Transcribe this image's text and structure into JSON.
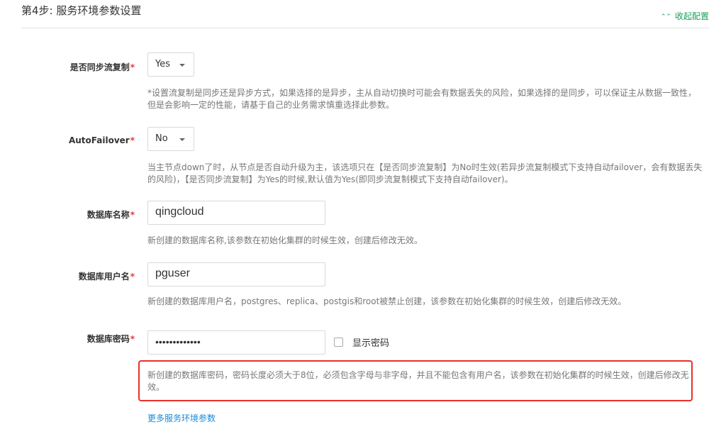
{
  "header": {
    "title": "第4步: 服务环境参数设置",
    "collapse_label": "收起配置",
    "collapse_icon": "double-chevron-up-icon"
  },
  "fields": {
    "sync_replication": {
      "label": "是否同步流复制",
      "required_mark": "*",
      "value": "Yes",
      "help": "*设置流复制是同步还是异步方式，如果选择的是异步，主从自动切换时可能会有数据丢失的风险，如果选择的是同步，可以保证主从数据一致性，但是会影响一定的性能，请基于自己的业务需求慎重选择此参数。"
    },
    "auto_failover": {
      "label": "AutoFailover",
      "required_mark": "*",
      "value": "No",
      "help": "当主节点down了时，从节点是否自动升级为主，该选项只在【是否同步流复制】为No时生效(若异步流复制模式下支持自动failover，会有数据丢失的风险)，【是否同步流复制】为Yes的时候,默认值为Yes(即同步流复制模式下支持自动failover)。"
    },
    "db_name": {
      "label": "数据库名称",
      "required_mark": "*",
      "value": "qingcloud",
      "help": "新创建的数据库名称,该参数在初始化集群的时候生效，创建后修改无效。"
    },
    "db_user": {
      "label": "数据库用户名",
      "required_mark": "*",
      "value": "pguser",
      "help": "新创建的数据库用户名，postgres、replica、postgis和root被禁止创建，该参数在初始化集群的时候生效，创建后修改无效。"
    },
    "db_password": {
      "label": "数据库密码",
      "required_mark": "*",
      "masked_value": "•••••••••••••",
      "show_password_label": "显示密码",
      "show_password_checked": false,
      "help": "新创建的数据库密码，密码长度必须大于8位，必须包含字母与非字母，并且不能包含有用户名，该参数在初始化集群的时候生效，创建后修改无效。"
    }
  },
  "more_link": "更多服务环境参数",
  "colors": {
    "accent_green": "#1aa05a",
    "link_blue": "#1a8cd8",
    "required_red": "#e4393c",
    "highlight_red": "#e8302a"
  }
}
